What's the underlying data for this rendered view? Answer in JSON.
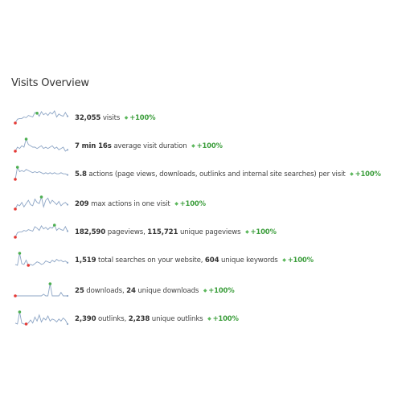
{
  "widget": {
    "title": "Visits Overview"
  },
  "colors": {
    "line": "#8ea6c6",
    "max_point": "#4caf50",
    "min_point": "#e53935",
    "evolution": "#3a9d3a"
  },
  "metrics": [
    {
      "id": "visits",
      "parts": [
        {
          "value": "32,055",
          "label": "visits"
        }
      ],
      "evolution": "+100%",
      "evolution_icon": "arrow-up-icon",
      "sparkline": [
        2,
        7,
        8,
        8,
        10,
        9,
        12,
        11,
        10,
        16,
        15,
        11,
        17,
        13,
        15,
        12,
        16,
        14,
        18,
        10,
        14,
        12,
        11,
        16,
        11
      ],
      "max_index": 10,
      "min_index": 0
    },
    {
      "id": "avg-visit-duration",
      "parts": [
        {
          "value": "7 min 16s",
          "label": "average visit duration"
        }
      ],
      "evolution": "+100%",
      "evolution_icon": "arrow-up-icon",
      "sparkline": [
        7,
        10,
        9,
        11,
        10,
        16,
        12,
        11,
        10,
        10,
        9,
        10,
        11,
        9,
        10,
        9,
        10,
        11,
        9,
        10,
        8,
        9,
        10,
        7,
        8
      ],
      "max_index": 5,
      "min_index": 0
    },
    {
      "id": "actions-per-visit",
      "parts": [
        {
          "value": "5.8",
          "label": "actions (page views, downloads, outlinks and internal site searches) per visit"
        }
      ],
      "evolution": "+100%",
      "evolution_icon": "arrow-up-icon",
      "sparkline": [
        4,
        15,
        11,
        12,
        11,
        13,
        12,
        11,
        10,
        11,
        10,
        11,
        10,
        9,
        10,
        9,
        10,
        9,
        10,
        9,
        9,
        10,
        9,
        9,
        8
      ],
      "max_index": 1,
      "min_index": 0
    },
    {
      "id": "max-actions",
      "parts": [
        {
          "value": "209",
          "label": "max actions in one visit"
        }
      ],
      "evolution": "+100%",
      "evolution_icon": "arrow-up-icon",
      "sparkline": [
        4,
        8,
        7,
        10,
        6,
        9,
        12,
        8,
        7,
        13,
        10,
        9,
        15,
        6,
        12,
        14,
        9,
        12,
        10,
        8,
        11,
        7,
        9,
        10,
        8
      ],
      "max_index": 12,
      "min_index": 0
    },
    {
      "id": "pageviews",
      "parts": [
        {
          "value": "182,590",
          "label": "pageviews,"
        },
        {
          "value": "115,721",
          "label": "unique pageviews"
        }
      ],
      "evolution": "+100%",
      "evolution_icon": "arrow-up-icon",
      "sparkline": [
        2,
        8,
        9,
        9,
        11,
        10,
        12,
        11,
        10,
        16,
        14,
        11,
        17,
        13,
        15,
        12,
        15,
        14,
        18,
        11,
        14,
        12,
        11,
        16,
        10
      ],
      "max_index": 18,
      "min_index": 0
    },
    {
      "id": "site-searches",
      "parts": [
        {
          "value": "1,519",
          "label": "total searches on your website,"
        },
        {
          "value": "604",
          "label": "unique keywords"
        }
      ],
      "evolution": "+100%",
      "evolution_icon": "arrow-up-icon",
      "sparkline": [
        3,
        2,
        16,
        4,
        3,
        8,
        2,
        3,
        2,
        4,
        6,
        5,
        3,
        4,
        7,
        6,
        5,
        8,
        6,
        9,
        7,
        8,
        6,
        7,
        5
      ],
      "max_index": 2,
      "min_index": 6
    },
    {
      "id": "downloads",
      "parts": [
        {
          "value": "25",
          "label": "downloads,"
        },
        {
          "value": "24",
          "label": "unique downloads"
        }
      ],
      "evolution": "+100%",
      "evolution_icon": "arrow-up-icon",
      "sparkline": [
        2,
        2,
        2,
        2,
        2,
        2,
        2,
        2,
        2,
        2,
        2,
        2,
        2,
        4,
        2,
        2,
        16,
        2,
        2,
        2,
        2,
        6,
        2,
        2,
        2
      ],
      "max_index": 16,
      "min_index": 0
    },
    {
      "id": "outlinks",
      "parts": [
        {
          "value": "2,390",
          "label": "outlinks,"
        },
        {
          "value": "2,238",
          "label": "unique outlinks"
        }
      ],
      "evolution": "+100%",
      "evolution_icon": "arrow-up-icon",
      "sparkline": [
        3,
        2,
        14,
        3,
        2,
        2,
        3,
        6,
        3,
        9,
        5,
        11,
        4,
        8,
        6,
        10,
        5,
        7,
        6,
        4,
        7,
        5,
        8,
        6,
        2
      ],
      "max_index": 2,
      "min_index": 5
    }
  ]
}
